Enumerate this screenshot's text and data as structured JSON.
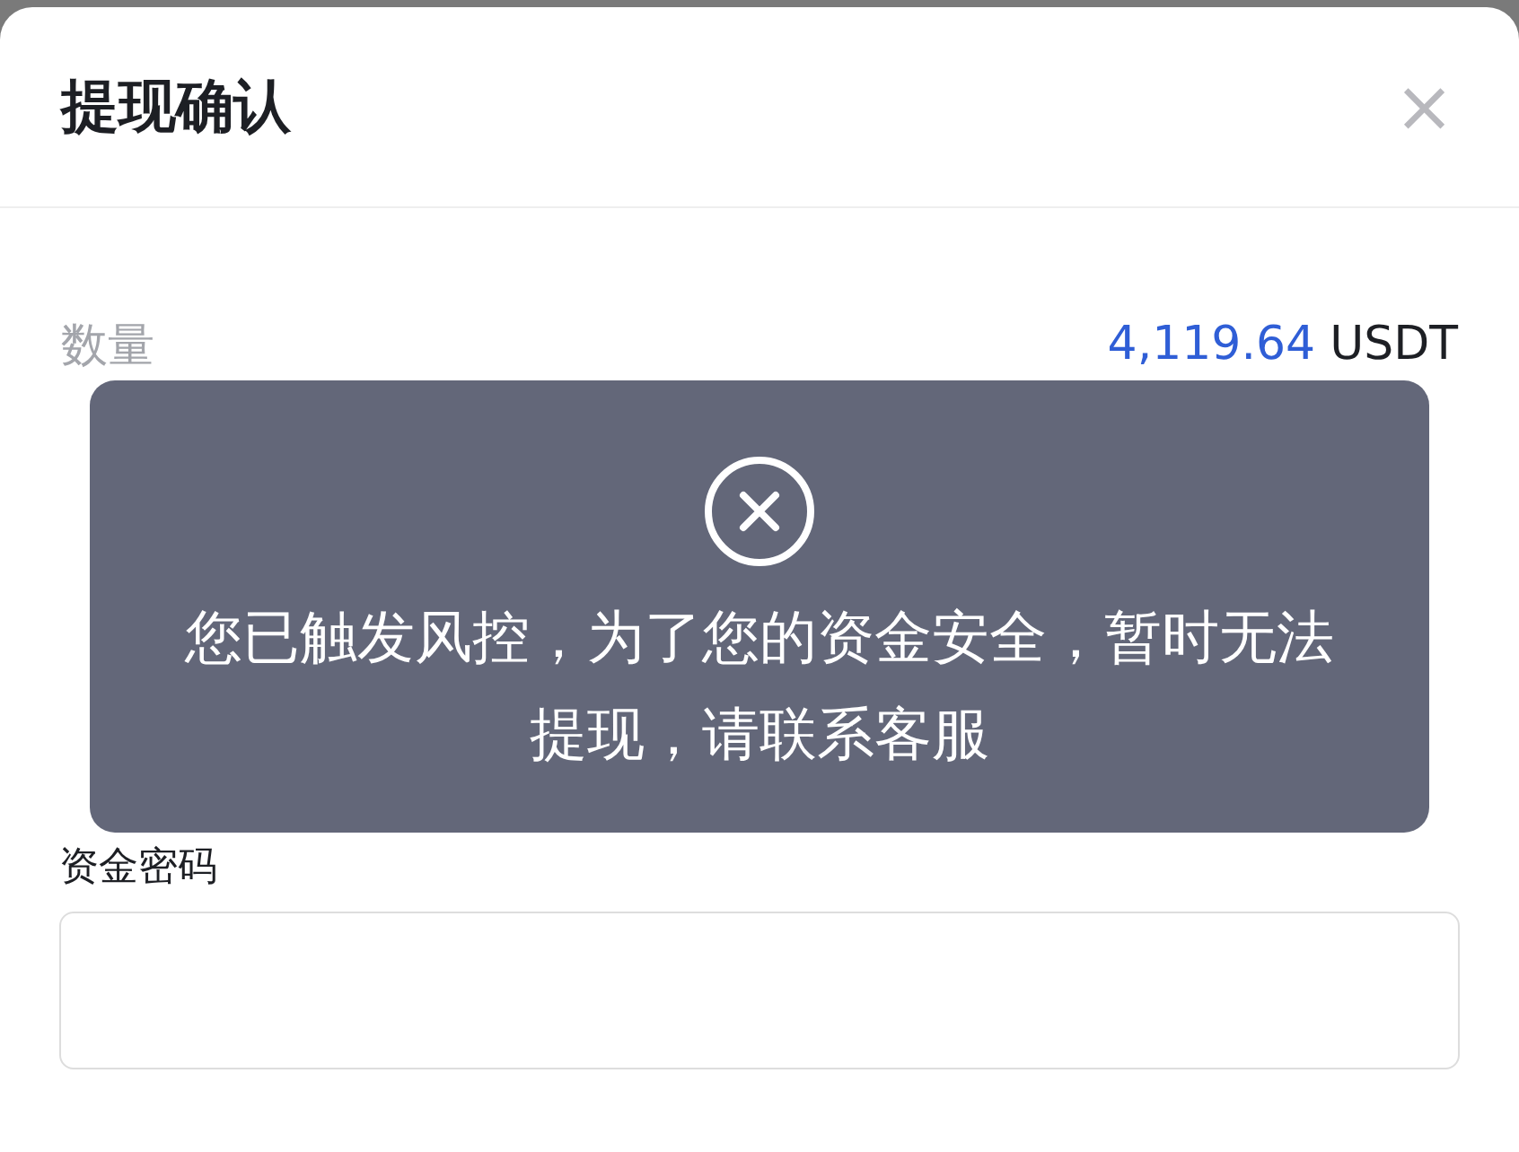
{
  "dialog": {
    "title": "提现确认",
    "close": "×"
  },
  "rows": [
    {
      "label": "数量",
      "value": "4,119.64",
      "unit": "USDT"
    }
  ],
  "password": {
    "label": "资金密码"
  },
  "toast": {
    "message": "您已触发风控，为了您的资金安全，暂时无法提现，请联系客服"
  }
}
